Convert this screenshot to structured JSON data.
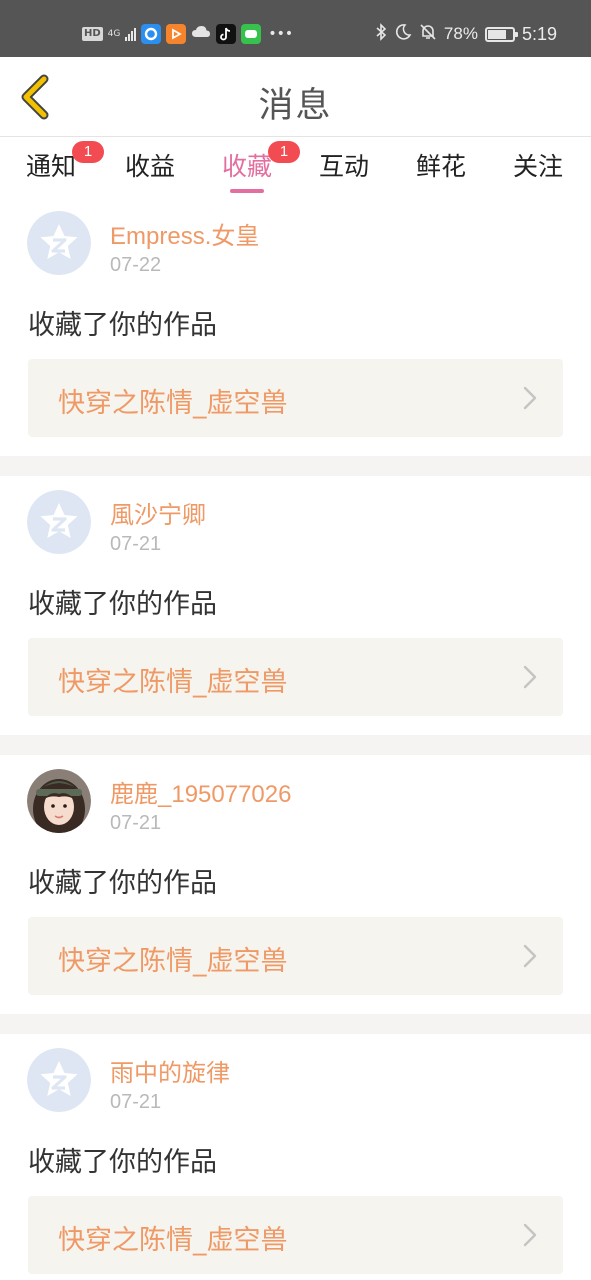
{
  "status_bar": {
    "hd": "HD",
    "network": "4G",
    "battery_percent": "78%",
    "battery_level": 0.78,
    "time": "5:19",
    "icons": [
      "signal-icon",
      "app-icon",
      "video-app-icon",
      "cloud-icon",
      "tiktok-icon",
      "game-app-icon",
      "more-icon",
      "bluetooth-icon",
      "moon-icon",
      "bell-off-icon",
      "battery-icon"
    ]
  },
  "header": {
    "title": "消息",
    "back_icon": "chevron-left-icon"
  },
  "tabs": [
    {
      "label": "通知",
      "badge": "1",
      "active": false
    },
    {
      "label": "收益",
      "badge": "",
      "active": false
    },
    {
      "label": "收藏",
      "badge": "1",
      "active": true
    },
    {
      "label": "互动",
      "badge": "",
      "active": false
    },
    {
      "label": "鲜花",
      "badge": "",
      "active": false
    },
    {
      "label": "关注",
      "badge": "",
      "active": false
    }
  ],
  "colors": {
    "accent": "#e36fa0",
    "username": "#ef9a66",
    "badge": "#f24b52",
    "back_arrow": "#f2c200"
  },
  "messages": [
    {
      "username": "Empress.女皇",
      "date": "07-22",
      "action": "收藏了你的作品",
      "work_title": "快穿之陈情_虚空兽",
      "avatar": "default-avatar-icon"
    },
    {
      "username": "風沙宁卿",
      "date": "07-21",
      "action": "收藏了你的作品",
      "work_title": "快穿之陈情_虚空兽",
      "avatar": "default-avatar-icon"
    },
    {
      "username": "鹿鹿_195077026",
      "date": "07-21",
      "action": "收藏了你的作品",
      "work_title": "快穿之陈情_虚空兽",
      "avatar": "user-photo-avatar"
    },
    {
      "username": "雨中的旋律",
      "date": "07-21",
      "action": "收藏了你的作品",
      "work_title": "快穿之陈情_虚空兽",
      "avatar": "default-avatar-icon"
    }
  ]
}
